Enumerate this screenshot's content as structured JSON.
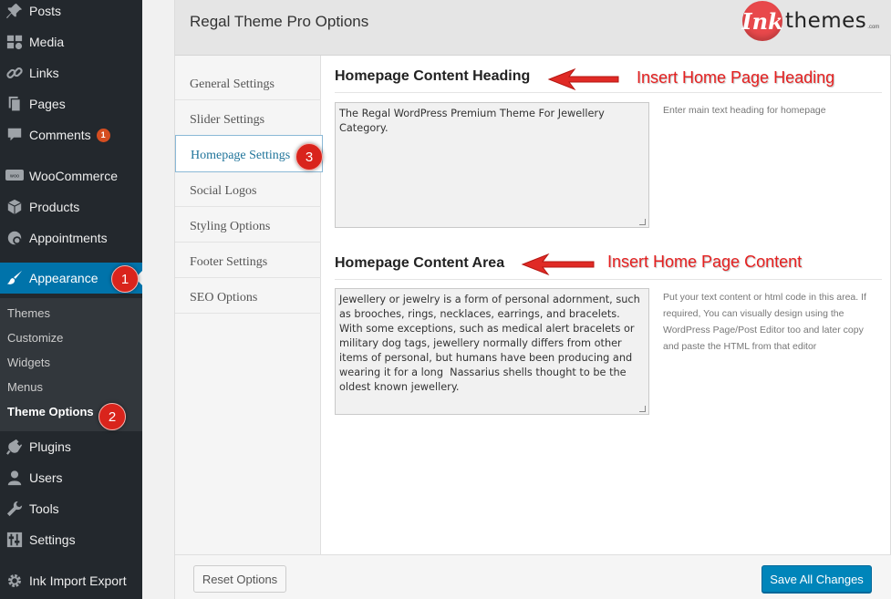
{
  "sidebar": {
    "items": [
      {
        "label": "Posts",
        "icon": "pushpin-icon"
      },
      {
        "label": "Media",
        "icon": "media-icon"
      },
      {
        "label": "Links",
        "icon": "link-icon"
      },
      {
        "label": "Pages",
        "icon": "pages-icon"
      },
      {
        "label": "Comments",
        "icon": "comment-icon",
        "badge": "1"
      },
      {
        "label": "WooCommerce",
        "icon": "woocommerce-icon"
      },
      {
        "label": "Products",
        "icon": "products-icon"
      },
      {
        "label": "Appointments",
        "icon": "appointments-icon"
      },
      {
        "label": "Appearance",
        "icon": "paintbrush-icon",
        "active": true
      },
      {
        "label": "Plugins",
        "icon": "plugin-icon"
      },
      {
        "label": "Users",
        "icon": "user-icon"
      },
      {
        "label": "Tools",
        "icon": "wrench-icon"
      },
      {
        "label": "Settings",
        "icon": "settings-icon"
      },
      {
        "label": "Ink Import Export",
        "icon": "gear-icon"
      }
    ],
    "submenu": [
      "Themes",
      "Customize",
      "Widgets",
      "Menus",
      "Theme Options"
    ],
    "submenu_current": "Theme Options",
    "active_color": "#0073aa",
    "bg_color": "#23282d"
  },
  "steps": [
    "1",
    "2",
    "3"
  ],
  "panel": {
    "title": "Regal Theme Pro Options",
    "logo": {
      "mark": "Ink",
      "text": "themes",
      "suffix": ".com"
    },
    "tabs": [
      "General Settings",
      "Slider Settings",
      "Homepage Settings",
      "Social Logos",
      "Styling Options",
      "Footer Settings",
      "SEO Options"
    ],
    "selected_tab": "Homepage Settings",
    "sections": [
      {
        "heading": "Homepage Content Heading",
        "value": "The Regal WordPress Premium Theme For Jewellery Category.",
        "description": "Enter main text heading for homepage",
        "annotation": "Insert Home Page Heading"
      },
      {
        "heading": "Homepage Content Area",
        "value": "Jewellery or jewelry is a form of personal adornment, such as brooches, rings, necklaces, earrings, and bracelets. With some exceptions, such as medical alert bracelets or military dog tags, jewellery normally differs from other items of personal, but humans have been producing and wearing it for a long  Nassarius shells thought to be the oldest known jewellery.",
        "description": "Put your text content or html code in this area. If required, You can visually design using the WordPress Page/Post Editor too and later copy and paste the HTML from that editor",
        "annotation": "Insert Home Page Content"
      }
    ],
    "reset_label": "Reset Options",
    "save_label": "Save All Changes",
    "annotation_color": "#e52020"
  }
}
